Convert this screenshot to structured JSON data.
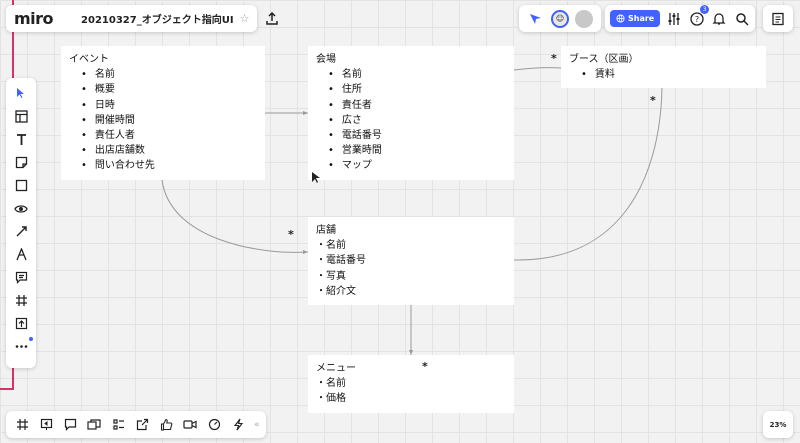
{
  "app": {
    "logo": "miro",
    "board_title": "20210327_オブジェクト指向UI"
  },
  "toolbar": {
    "share_label": "Share",
    "notifications": "3",
    "zoom": "23%"
  },
  "notes": {
    "event": {
      "title": "イベント",
      "items": [
        "名前",
        "概要",
        "日時",
        "開催時間",
        "責任人者",
        "出店店舗数",
        "問い合わせ先"
      ]
    },
    "venue": {
      "title": "会場",
      "items": [
        "名前",
        "住所",
        "責任者",
        "広さ",
        "電話番号",
        "営業時間",
        "マップ"
      ]
    },
    "booth": {
      "title": "ブース（区画）",
      "items": [
        "賃料"
      ]
    },
    "store": {
      "title": "店舗",
      "items": [
        "名前",
        "電話番号",
        "写真",
        "紹介文"
      ]
    },
    "menu": {
      "title": "メニュー",
      "items": [
        "名前",
        "価格"
      ]
    }
  },
  "multiplicities": {
    "booth_left": "*",
    "booth_bottom": "*",
    "store_left": "*",
    "menu_top": "*"
  },
  "colors": {
    "accent": "#4262ff",
    "frame": "#d6336c"
  }
}
